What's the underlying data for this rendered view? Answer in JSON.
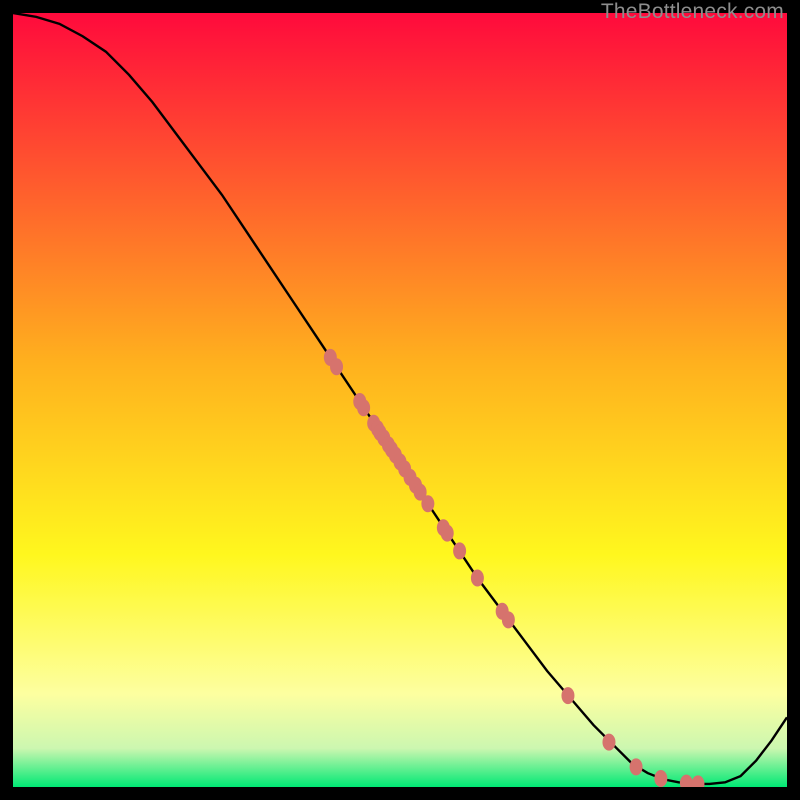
{
  "watermark": "TheBottleneck.com",
  "colors": {
    "gradient_top": "#ff0a3c",
    "gradient_mid_up": "#ffb01e",
    "gradient_mid": "#fff71e",
    "gradient_low": "#fdffa0",
    "gradient_min": "#00e874",
    "curve": "#000000",
    "marker_fill": "#d6736d",
    "marker_stroke": "#b75a55"
  },
  "chart_data": {
    "type": "line",
    "title": "",
    "xlabel": "",
    "ylabel": "",
    "xlim": [
      0,
      100
    ],
    "ylim": [
      0,
      100
    ],
    "series": [
      {
        "name": "bottleneck-curve",
        "x": [
          0,
          3,
          6,
          9,
          12,
          15,
          18,
          21,
          24,
          27,
          30,
          33,
          36,
          39,
          42,
          45,
          48,
          51,
          54,
          57,
          60,
          63,
          66,
          69,
          72,
          75,
          78,
          80,
          82,
          84,
          86,
          88,
          90,
          92,
          94,
          96,
          98,
          100
        ],
        "y": [
          100,
          99.5,
          98.6,
          97.0,
          95.0,
          92.0,
          88.5,
          84.5,
          80.5,
          76.5,
          72.0,
          67.5,
          63.0,
          58.5,
          54.0,
          49.5,
          45.0,
          40.5,
          36.0,
          31.5,
          27.0,
          23.0,
          19.0,
          15.0,
          11.5,
          8.0,
          5.0,
          3.0,
          1.8,
          1.0,
          0.6,
          0.4,
          0.4,
          0.6,
          1.4,
          3.4,
          6.0,
          9.0
        ]
      }
    ],
    "markers": [
      {
        "x": 41.0,
        "y": 55.5
      },
      {
        "x": 41.8,
        "y": 54.3
      },
      {
        "x": 44.8,
        "y": 49.8
      },
      {
        "x": 45.3,
        "y": 49.0
      },
      {
        "x": 46.6,
        "y": 47.0
      },
      {
        "x": 47.1,
        "y": 46.3
      },
      {
        "x": 47.4,
        "y": 45.8
      },
      {
        "x": 47.9,
        "y": 45.1
      },
      {
        "x": 48.5,
        "y": 44.2
      },
      {
        "x": 48.9,
        "y": 43.6
      },
      {
        "x": 49.4,
        "y": 42.9
      },
      {
        "x": 50.0,
        "y": 42.0
      },
      {
        "x": 50.6,
        "y": 41.1
      },
      {
        "x": 51.3,
        "y": 40.0
      },
      {
        "x": 52.0,
        "y": 39.0
      },
      {
        "x": 52.6,
        "y": 38.1
      },
      {
        "x": 53.6,
        "y": 36.6
      },
      {
        "x": 55.6,
        "y": 33.5
      },
      {
        "x": 56.1,
        "y": 32.8
      },
      {
        "x": 57.7,
        "y": 30.5
      },
      {
        "x": 60.0,
        "y": 27.0
      },
      {
        "x": 63.2,
        "y": 22.7
      },
      {
        "x": 64.0,
        "y": 21.6
      },
      {
        "x": 71.7,
        "y": 11.8
      },
      {
        "x": 77.0,
        "y": 5.8
      },
      {
        "x": 80.5,
        "y": 2.6
      },
      {
        "x": 83.7,
        "y": 1.1
      },
      {
        "x": 87.0,
        "y": 0.5
      },
      {
        "x": 88.5,
        "y": 0.4
      }
    ]
  }
}
